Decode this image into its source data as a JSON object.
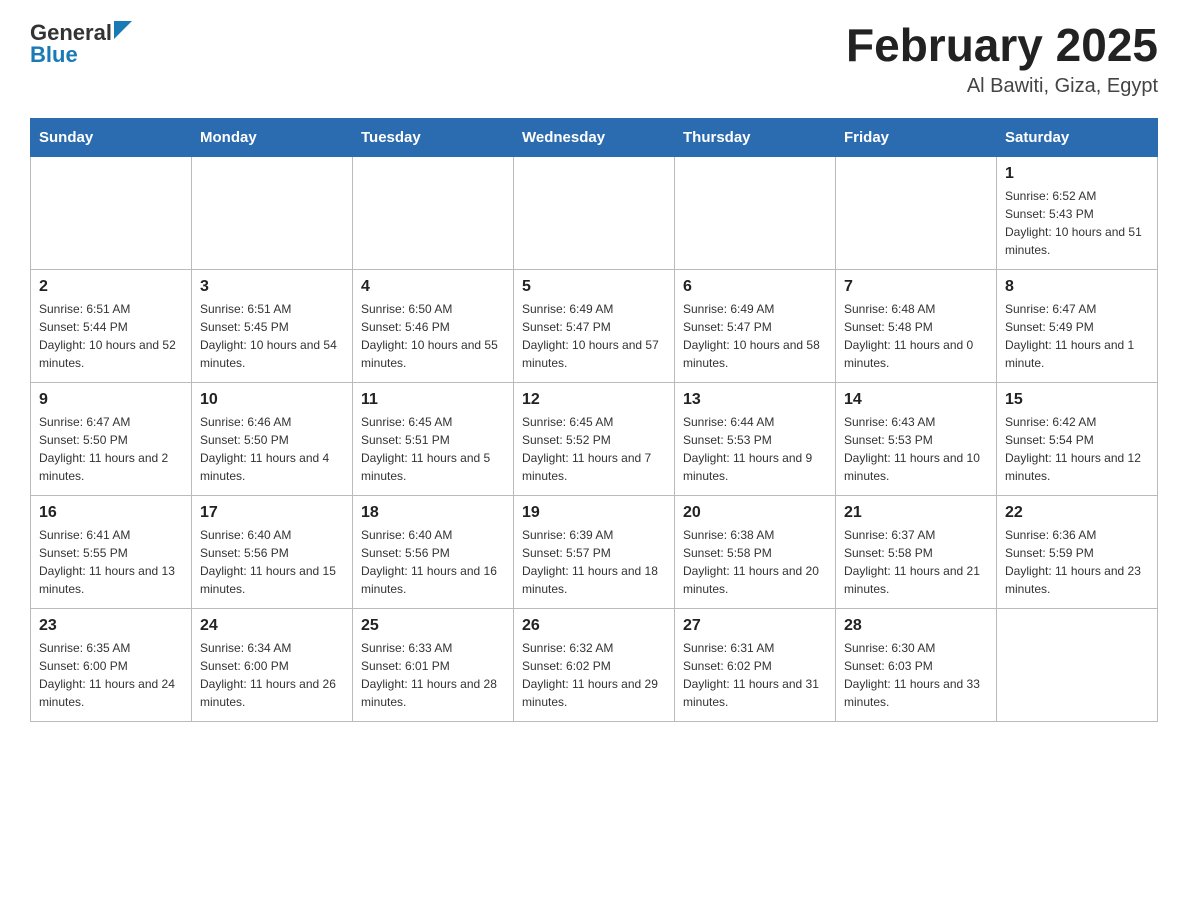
{
  "header": {
    "title": "February 2025",
    "location": "Al Bawiti, Giza, Egypt",
    "logo_general": "General",
    "logo_blue": "Blue"
  },
  "weekdays": [
    "Sunday",
    "Monday",
    "Tuesday",
    "Wednesday",
    "Thursday",
    "Friday",
    "Saturday"
  ],
  "weeks": [
    [
      {
        "day": "",
        "sunrise": "",
        "sunset": "",
        "daylight": ""
      },
      {
        "day": "",
        "sunrise": "",
        "sunset": "",
        "daylight": ""
      },
      {
        "day": "",
        "sunrise": "",
        "sunset": "",
        "daylight": ""
      },
      {
        "day": "",
        "sunrise": "",
        "sunset": "",
        "daylight": ""
      },
      {
        "day": "",
        "sunrise": "",
        "sunset": "",
        "daylight": ""
      },
      {
        "day": "",
        "sunrise": "",
        "sunset": "",
        "daylight": ""
      },
      {
        "day": "1",
        "sunrise": "Sunrise: 6:52 AM",
        "sunset": "Sunset: 5:43 PM",
        "daylight": "Daylight: 10 hours and 51 minutes."
      }
    ],
    [
      {
        "day": "2",
        "sunrise": "Sunrise: 6:51 AM",
        "sunset": "Sunset: 5:44 PM",
        "daylight": "Daylight: 10 hours and 52 minutes."
      },
      {
        "day": "3",
        "sunrise": "Sunrise: 6:51 AM",
        "sunset": "Sunset: 5:45 PM",
        "daylight": "Daylight: 10 hours and 54 minutes."
      },
      {
        "day": "4",
        "sunrise": "Sunrise: 6:50 AM",
        "sunset": "Sunset: 5:46 PM",
        "daylight": "Daylight: 10 hours and 55 minutes."
      },
      {
        "day": "5",
        "sunrise": "Sunrise: 6:49 AM",
        "sunset": "Sunset: 5:47 PM",
        "daylight": "Daylight: 10 hours and 57 minutes."
      },
      {
        "day": "6",
        "sunrise": "Sunrise: 6:49 AM",
        "sunset": "Sunset: 5:47 PM",
        "daylight": "Daylight: 10 hours and 58 minutes."
      },
      {
        "day": "7",
        "sunrise": "Sunrise: 6:48 AM",
        "sunset": "Sunset: 5:48 PM",
        "daylight": "Daylight: 11 hours and 0 minutes."
      },
      {
        "day": "8",
        "sunrise": "Sunrise: 6:47 AM",
        "sunset": "Sunset: 5:49 PM",
        "daylight": "Daylight: 11 hours and 1 minute."
      }
    ],
    [
      {
        "day": "9",
        "sunrise": "Sunrise: 6:47 AM",
        "sunset": "Sunset: 5:50 PM",
        "daylight": "Daylight: 11 hours and 2 minutes."
      },
      {
        "day": "10",
        "sunrise": "Sunrise: 6:46 AM",
        "sunset": "Sunset: 5:50 PM",
        "daylight": "Daylight: 11 hours and 4 minutes."
      },
      {
        "day": "11",
        "sunrise": "Sunrise: 6:45 AM",
        "sunset": "Sunset: 5:51 PM",
        "daylight": "Daylight: 11 hours and 5 minutes."
      },
      {
        "day": "12",
        "sunrise": "Sunrise: 6:45 AM",
        "sunset": "Sunset: 5:52 PM",
        "daylight": "Daylight: 11 hours and 7 minutes."
      },
      {
        "day": "13",
        "sunrise": "Sunrise: 6:44 AM",
        "sunset": "Sunset: 5:53 PM",
        "daylight": "Daylight: 11 hours and 9 minutes."
      },
      {
        "day": "14",
        "sunrise": "Sunrise: 6:43 AM",
        "sunset": "Sunset: 5:53 PM",
        "daylight": "Daylight: 11 hours and 10 minutes."
      },
      {
        "day": "15",
        "sunrise": "Sunrise: 6:42 AM",
        "sunset": "Sunset: 5:54 PM",
        "daylight": "Daylight: 11 hours and 12 minutes."
      }
    ],
    [
      {
        "day": "16",
        "sunrise": "Sunrise: 6:41 AM",
        "sunset": "Sunset: 5:55 PM",
        "daylight": "Daylight: 11 hours and 13 minutes."
      },
      {
        "day": "17",
        "sunrise": "Sunrise: 6:40 AM",
        "sunset": "Sunset: 5:56 PM",
        "daylight": "Daylight: 11 hours and 15 minutes."
      },
      {
        "day": "18",
        "sunrise": "Sunrise: 6:40 AM",
        "sunset": "Sunset: 5:56 PM",
        "daylight": "Daylight: 11 hours and 16 minutes."
      },
      {
        "day": "19",
        "sunrise": "Sunrise: 6:39 AM",
        "sunset": "Sunset: 5:57 PM",
        "daylight": "Daylight: 11 hours and 18 minutes."
      },
      {
        "day": "20",
        "sunrise": "Sunrise: 6:38 AM",
        "sunset": "Sunset: 5:58 PM",
        "daylight": "Daylight: 11 hours and 20 minutes."
      },
      {
        "day": "21",
        "sunrise": "Sunrise: 6:37 AM",
        "sunset": "Sunset: 5:58 PM",
        "daylight": "Daylight: 11 hours and 21 minutes."
      },
      {
        "day": "22",
        "sunrise": "Sunrise: 6:36 AM",
        "sunset": "Sunset: 5:59 PM",
        "daylight": "Daylight: 11 hours and 23 minutes."
      }
    ],
    [
      {
        "day": "23",
        "sunrise": "Sunrise: 6:35 AM",
        "sunset": "Sunset: 6:00 PM",
        "daylight": "Daylight: 11 hours and 24 minutes."
      },
      {
        "day": "24",
        "sunrise": "Sunrise: 6:34 AM",
        "sunset": "Sunset: 6:00 PM",
        "daylight": "Daylight: 11 hours and 26 minutes."
      },
      {
        "day": "25",
        "sunrise": "Sunrise: 6:33 AM",
        "sunset": "Sunset: 6:01 PM",
        "daylight": "Daylight: 11 hours and 28 minutes."
      },
      {
        "day": "26",
        "sunrise": "Sunrise: 6:32 AM",
        "sunset": "Sunset: 6:02 PM",
        "daylight": "Daylight: 11 hours and 29 minutes."
      },
      {
        "day": "27",
        "sunrise": "Sunrise: 6:31 AM",
        "sunset": "Sunset: 6:02 PM",
        "daylight": "Daylight: 11 hours and 31 minutes."
      },
      {
        "day": "28",
        "sunrise": "Sunrise: 6:30 AM",
        "sunset": "Sunset: 6:03 PM",
        "daylight": "Daylight: 11 hours and 33 minutes."
      },
      {
        "day": "",
        "sunrise": "",
        "sunset": "",
        "daylight": ""
      }
    ]
  ]
}
